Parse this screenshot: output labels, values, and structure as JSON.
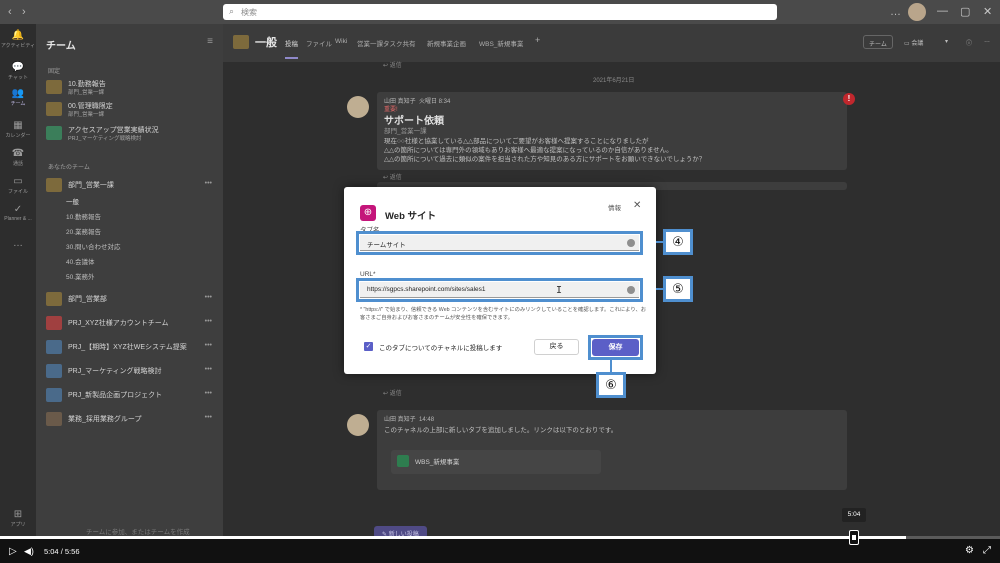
{
  "window": {
    "search_placeholder": "検索",
    "back_glyph": "‹",
    "forward_glyph": "›",
    "more_glyph": "…",
    "minimize_glyph": "—",
    "maximize_glyph": "▢",
    "close_glyph": "✕"
  },
  "rail": [
    {
      "icon": "bell-icon",
      "label": "アクティビティ",
      "glyph": "🔔"
    },
    {
      "icon": "chat-icon",
      "label": "チャット",
      "glyph": "💬"
    },
    {
      "icon": "teams-icon",
      "label": "チーム",
      "glyph": "👥"
    },
    {
      "icon": "calendar-icon",
      "label": "カレンダー",
      "glyph": "▦"
    },
    {
      "icon": "phone-icon",
      "label": "通話",
      "glyph": "☎"
    },
    {
      "icon": "file-icon",
      "label": "ファイル",
      "glyph": "▭"
    },
    {
      "icon": "planner-icon",
      "label": "Planner & ...",
      "glyph": "✓"
    },
    {
      "icon": "more-apps-icon",
      "label": "",
      "glyph": "…"
    },
    {
      "icon": "apps-icon",
      "label": "アプリ",
      "glyph": "⊞"
    }
  ],
  "team_panel": {
    "title": "チーム",
    "filter_glyph": "≡",
    "pinned_label": "固定",
    "your_teams_label": "あなたのチーム",
    "pinned": [
      {
        "name": "10.勤務報告",
        "sub": "部門_営業一課"
      },
      {
        "name": "00.管理職限定",
        "sub": "部門_営業一課"
      },
      {
        "name": "アクセスアップ営業実績状況",
        "sub": "PRJ_マーケティング戦略検討"
      }
    ],
    "teams": [
      {
        "name": "部門_営業一課",
        "sub": ""
      },
      {
        "name": "部門_営業部",
        "sub": ""
      },
      {
        "name": "PRJ_XYZ社様アカウントチーム",
        "sub": ""
      },
      {
        "name": "PRJ_【期時】XYZ社WEシステム提案",
        "sub": ""
      },
      {
        "name": "PRJ_マーケティング戦略検討",
        "sub": ""
      },
      {
        "name": "PRJ_新製品企画プロジェクト",
        "sub": ""
      },
      {
        "name": "業務_採用業務グループ",
        "sub": ""
      }
    ],
    "channels": [
      "一般",
      "10.勤務報告",
      "20.業務報告",
      "30.問い合わせ対応",
      "40.会議体",
      "50.業務外"
    ],
    "bottom_partial": "チームに参加、またはチームを作成"
  },
  "channel_header": {
    "title": "一般",
    "tabs": [
      "投稿",
      "ファイル",
      "Wiki",
      "営業一課タスク共有",
      "新規事業企画",
      "WBS_新規事業",
      "+"
    ],
    "team_button": "チーム",
    "meet_button": "会議",
    "meet_dropdown_glyph": "▾",
    "info_glyph": "ⓘ",
    "more_glyph": "…"
  },
  "feed": {
    "reply_label": "↩ 返信",
    "date": "2021年6月21日",
    "post1": {
      "author": "山田 真知子",
      "time": "火曜日 8:34",
      "importance": "重要!",
      "title": "サポート依頼",
      "team": "部門_営業一課",
      "lines": [
        "現在○○社様と協業している△△部品についてご要望がお客様へ提案することになりましたが",
        "△△の箇所については専門外の領域もありお客様へ最適な提案になっているのか自信がありません。",
        "△△の箇所について過去に類似の案件を担当された方や知見のある方にサポートをお願いできないでしょうか？"
      ],
      "alert_glyph": "!"
    },
    "post2": {
      "author": "山田 真知子",
      "time": "14:48",
      "line": "このチャネルの上部に新しいタブを追加しました。リンクは以下のとおりです。",
      "card": "WBS_新規事業"
    },
    "new_post_button": "新しい投稿"
  },
  "dialog": {
    "title": "Web サイト",
    "info_link": "情報",
    "close_glyph": "✕",
    "globe_glyph": "⊕",
    "tab_name_label": "タブ名",
    "tab_name_value": "チームサイト",
    "url_label": "URL*",
    "url_value": "https://sgpcs.sharepoint.com/sites/sales1",
    "notice_lines": [
      "* \"https://\" で始まり、信頼できる Web コンテンツを含むサイトにのみリンクしていることを確認します。これにより、お",
      "客さまご自身およびお客さまのチームが安全性を確保できます。"
    ],
    "checkbox_checked": true,
    "checkbox_glyph": "✓",
    "checkbox_label": "このタブについてのチャネルに投稿します",
    "back_button": "戻る",
    "save_button": "保存"
  },
  "callouts": [
    "④",
    "⑤",
    "⑥"
  ],
  "cursor_glyph": "I",
  "player": {
    "current": "5:04",
    "separator": "/",
    "total": "5:56",
    "hover_time": "5:04",
    "progress_fraction": 0.906,
    "play_glyph": "▷",
    "volume_glyph": "◀)",
    "settings_glyph": "⚙",
    "fullscreen_glyph": "⤢"
  },
  "colors": {
    "accent": "#5b5fc7",
    "callout_border": "#4f8fcf",
    "web_icon": "#c4157a",
    "alert": "#c1272d"
  }
}
